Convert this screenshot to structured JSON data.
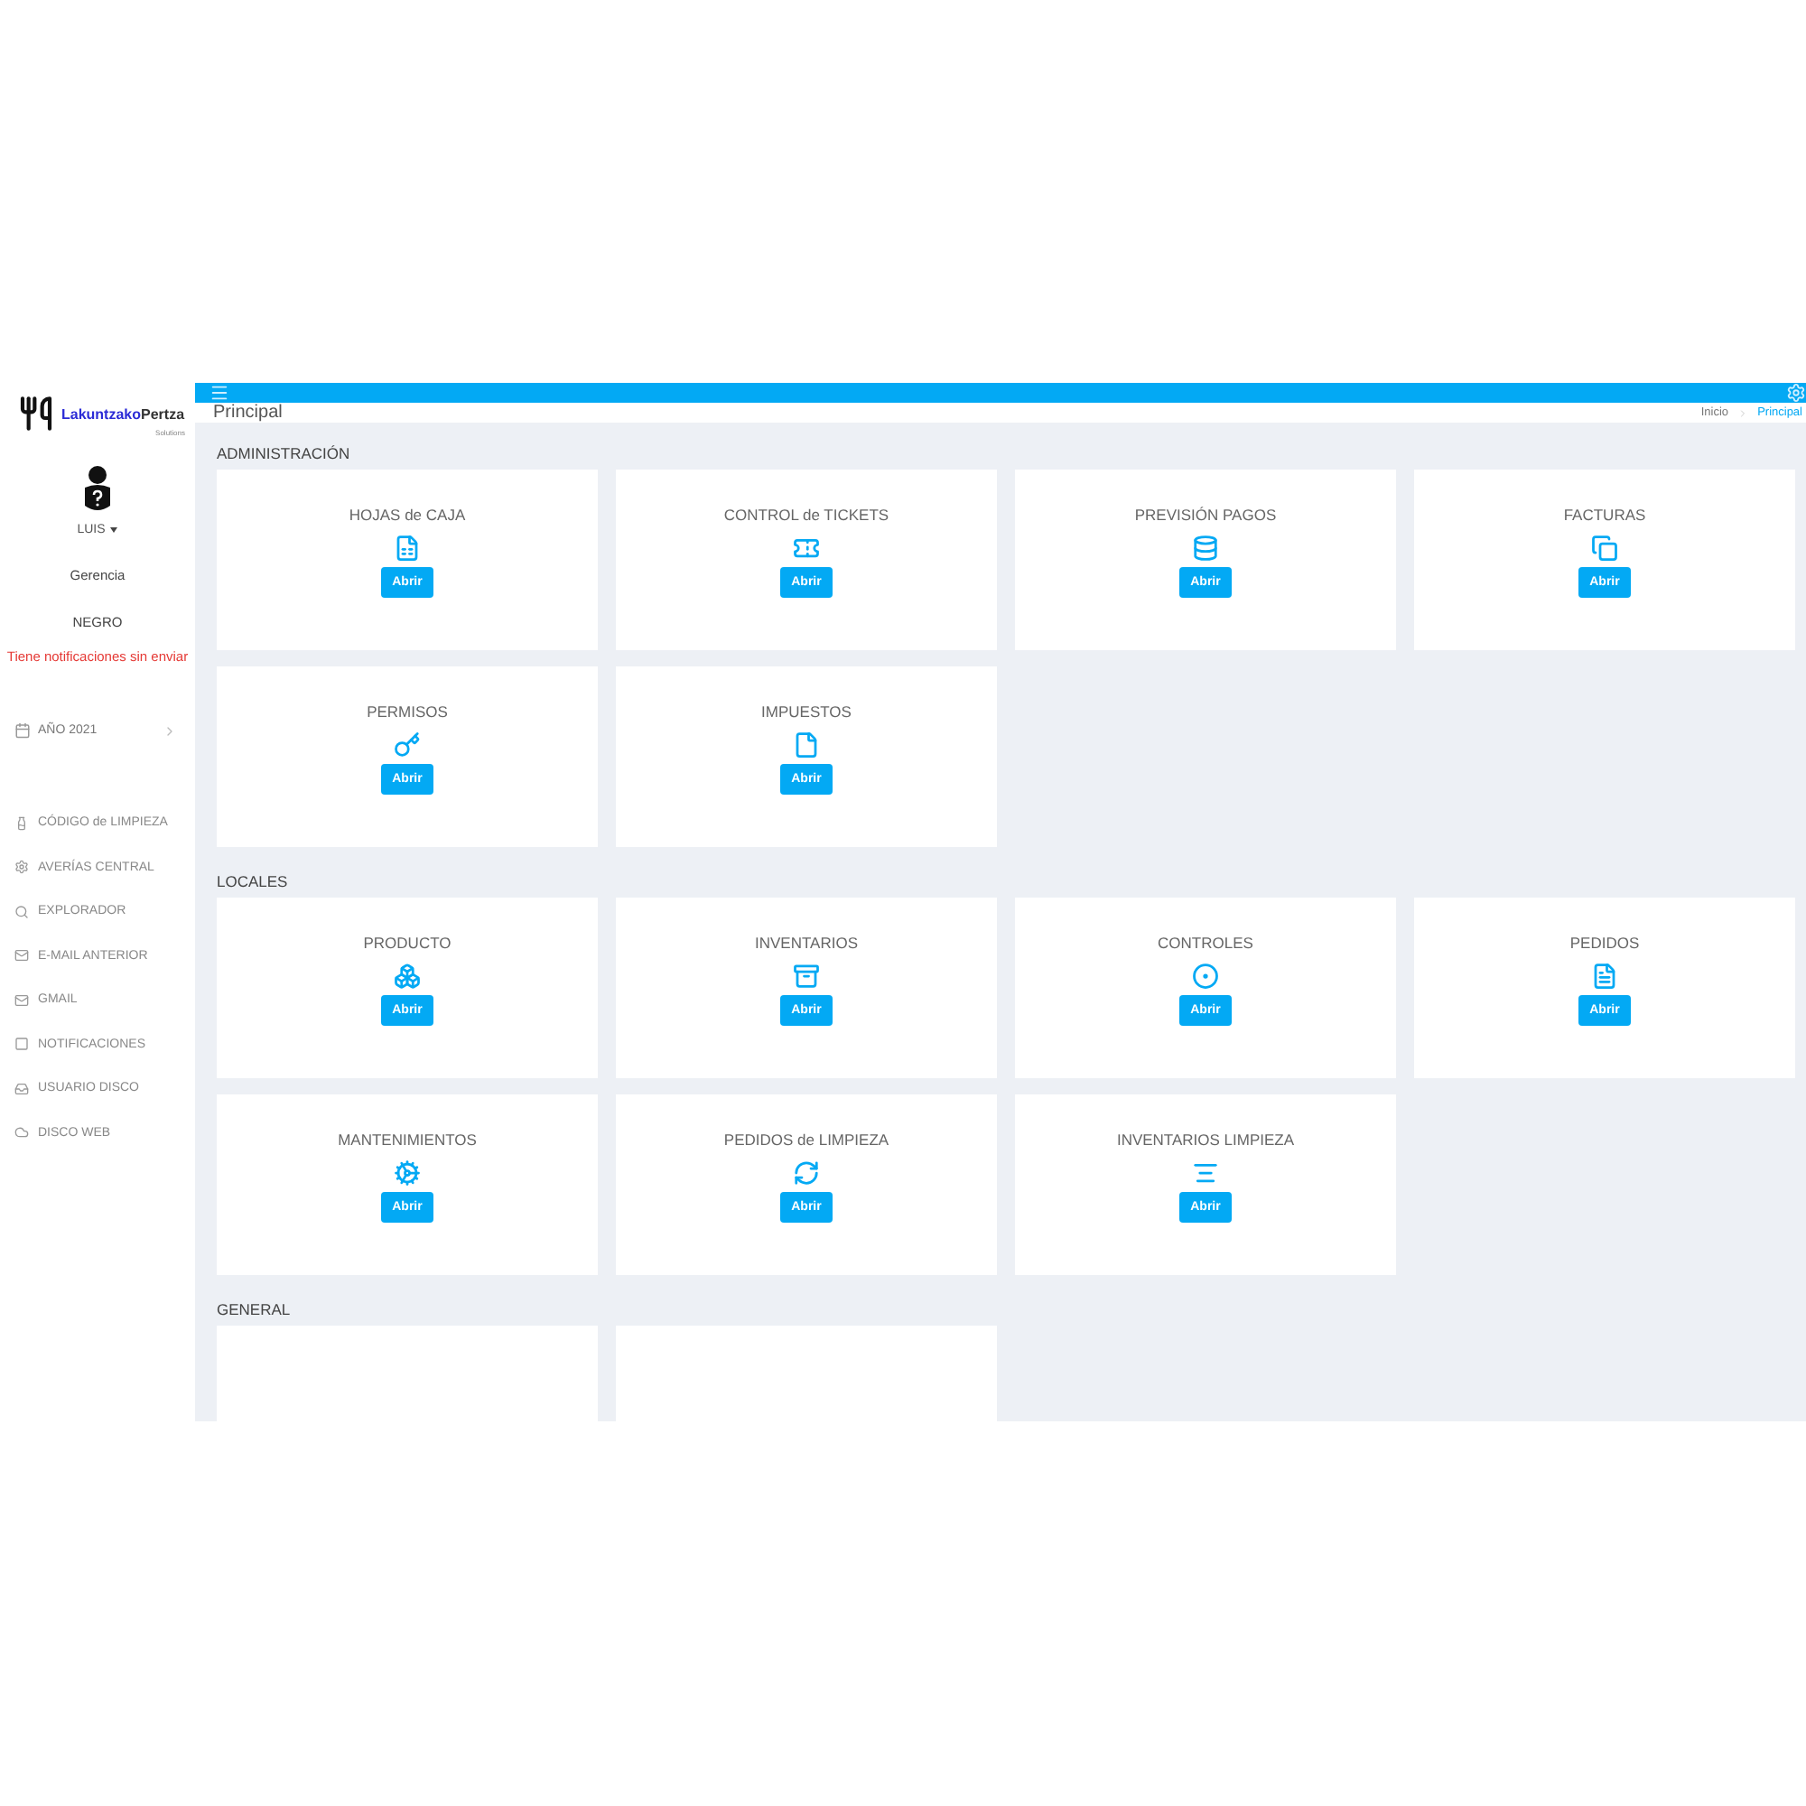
{
  "brand": {
    "name_part_1": "Lakuntzako",
    "name_part_2": "Pertza",
    "tagline": "Solutions"
  },
  "user": {
    "name": "LUIS",
    "role": "Gerencia",
    "group": "NEGRO",
    "alert": "Tiene notificaciones sin enviar"
  },
  "year_menu": {
    "label": "AÑO 2021"
  },
  "sidebar": {
    "items": [
      {
        "label": "CÓDIGO de LIMPIEZA"
      },
      {
        "label": "AVERÍAS CENTRAL"
      },
      {
        "label": "EXPLORADOR"
      },
      {
        "label": "E-MAIL ANTERIOR"
      },
      {
        "label": "GMAIL"
      },
      {
        "label": "NOTIFICACIONES"
      },
      {
        "label": "USUARIO DISCO"
      },
      {
        "label": "DISCO WEB"
      }
    ]
  },
  "page_header": {
    "title": "Principal",
    "breadcrumb": [
      {
        "label": "Inicio",
        "selected": false
      },
      {
        "label": "Principal",
        "selected": true
      }
    ]
  },
  "sections": [
    {
      "title": "ADMINISTRACIÓN",
      "cards": [
        {
          "kind": "tile",
          "title": "HOJAS de CAJA",
          "button": "Abrir"
        },
        {
          "kind": "tile",
          "title": "CONTROL de TICKETS",
          "button": "Abrir"
        },
        {
          "kind": "tile",
          "title": "PREVISIÓN PAGOS",
          "button": "Abrir"
        },
        {
          "kind": "tile",
          "title": "FACTURAS",
          "button": "Abrir"
        },
        {
          "kind": "tile",
          "title": "PERMISOS",
          "button": "Abrir"
        },
        {
          "kind": "tile",
          "title": "IMPUESTOS",
          "button": "Abrir"
        }
      ]
    },
    {
      "title": "LOCALES",
      "cards": [
        {
          "kind": "tile",
          "title": "PRODUCTO",
          "button": "Abrir"
        },
        {
          "kind": "tile",
          "title": "INVENTARIOS",
          "button": "Abrir"
        },
        {
          "kind": "tile",
          "title": "CONTROLES",
          "button": "Abrir"
        },
        {
          "kind": "tile",
          "title": "PEDIDOS",
          "button": "Abrir"
        },
        {
          "kind": "tile",
          "title": "MANTENIMIENTOS",
          "button": "Abrir"
        },
        {
          "kind": "tile",
          "title": "PEDIDOS de LIMPIEZA",
          "button": "Abrir"
        },
        {
          "kind": "tile",
          "title": "INVENTARIOS LIMPIEZA",
          "button": "Abrir"
        }
      ]
    },
    {
      "title": "GENERAL",
      "cards": [
        {
          "kind": "cut_off"
        },
        {
          "kind": "cut_off"
        }
      ]
    }
  ]
}
